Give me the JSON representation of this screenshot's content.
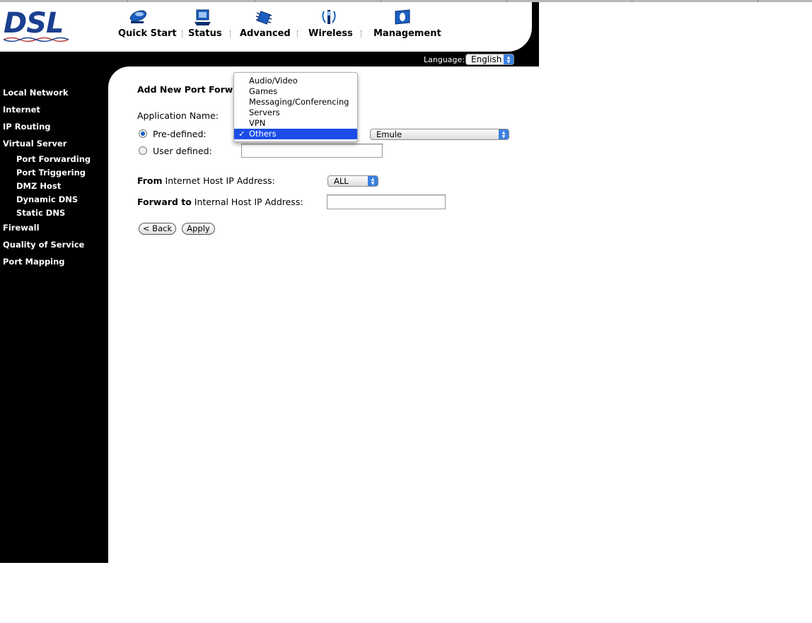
{
  "logo": {
    "text": "DSL"
  },
  "nav": [
    {
      "label": "Quick Start",
      "icon": "modem-icon"
    },
    {
      "label": "Status",
      "icon": "computer-icon"
    },
    {
      "label": "Advanced",
      "icon": "chip-icon"
    },
    {
      "label": "Wireless",
      "icon": "antenna-icon"
    },
    {
      "label": "Management",
      "icon": "monitor-icon"
    }
  ],
  "language": {
    "label": "Language:",
    "value": "English"
  },
  "sidebar": {
    "items": [
      "Local Network",
      "Internet",
      "IP Routing",
      "Virtual Server"
    ],
    "subitems": [
      "Port Forwarding",
      "Port Triggering",
      "DMZ Host",
      "Dynamic DNS",
      "Static DNS"
    ],
    "items_after": [
      "Firewall",
      "Quality of Service",
      "Port Mapping"
    ]
  },
  "form": {
    "title": "Add New Port Forwa",
    "app_name_label": "Application Name:",
    "predefined_label": "Pre-defined:",
    "userdefined_label": "User defined:",
    "predefined_value": "Emule",
    "from_bold": "From",
    "from_rest": " Internet Host IP Address:",
    "from_value": "ALL",
    "forward_bold": "Forward to",
    "forward_rest": " Internal Host IP Address:",
    "forward_value": "",
    "back_label": "< Back",
    "apply_label": "Apply"
  },
  "category_dropdown": {
    "options": [
      "Audio/Video",
      "Games",
      "Messaging/Conferencing",
      "Servers",
      "VPN",
      "Others"
    ],
    "selected": "Others",
    "check": "✓"
  },
  "colors": {
    "brand": "#1b3f8f",
    "accent": "#1d4de8"
  }
}
